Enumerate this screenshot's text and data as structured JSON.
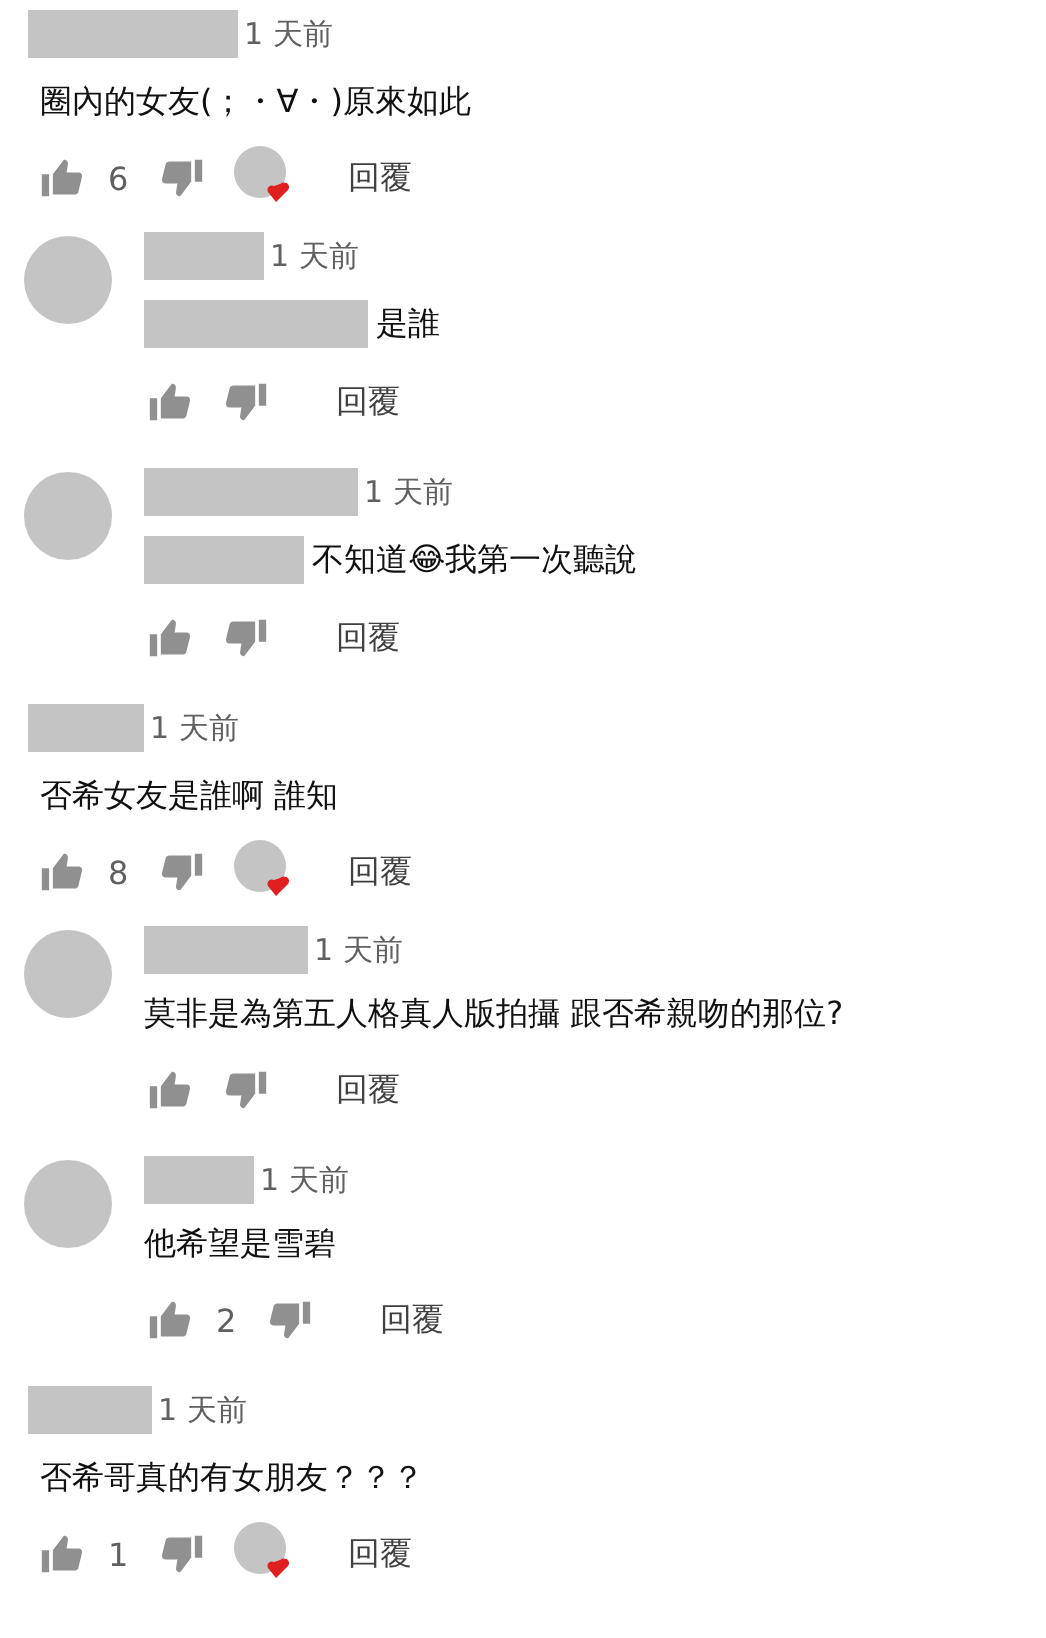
{
  "comments": [
    {
      "time": "1 天前",
      "text": "圈內的女友(；・∀・)原來如此",
      "likes": "6",
      "hearted": true,
      "reply": "回覆",
      "replies": [
        {
          "time": "1 天前",
          "text": "是誰",
          "hidden_prefix": true,
          "reply": "回覆"
        },
        {
          "time": "1 天前",
          "text": "不知道😂我第一次聽說",
          "hidden_prefix": true,
          "reply": "回覆"
        }
      ]
    },
    {
      "time": "1 天前",
      "text": "否希女友是誰啊 誰知",
      "likes": "8",
      "hearted": true,
      "reply": "回覆",
      "replies": [
        {
          "time": "1 天前",
          "text": "莫非是為第五人格真人版拍攝 跟否希親吻的那位?",
          "hidden_prefix": false,
          "reply": "回覆"
        },
        {
          "time": "1 天前",
          "text": "他希望是雪碧",
          "hidden_prefix": false,
          "likes": "2",
          "reply": "回覆"
        }
      ]
    },
    {
      "time": "1 天前",
      "text": "否希哥真的有女朋友？？？",
      "likes": "1",
      "hearted": true,
      "reply": "回覆"
    }
  ]
}
